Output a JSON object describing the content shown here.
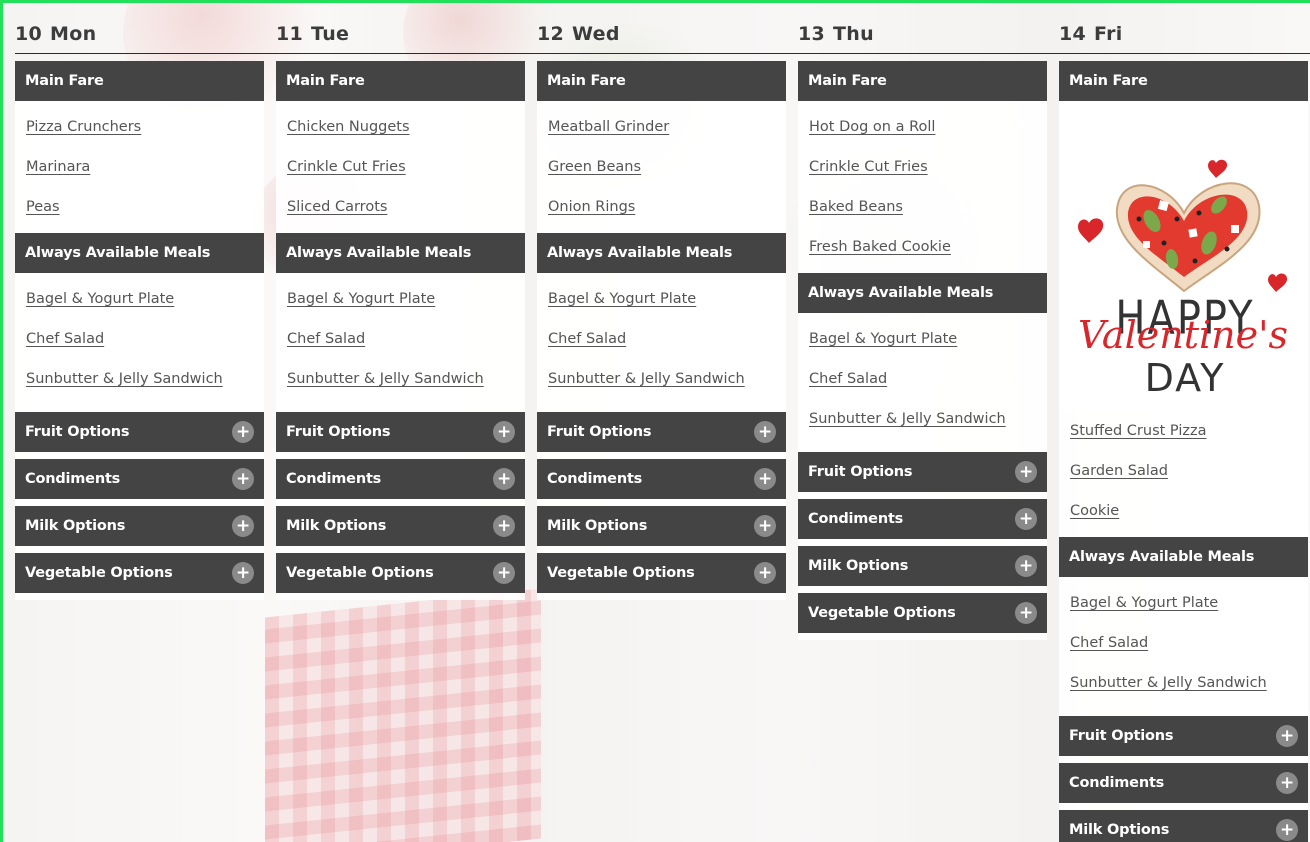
{
  "days": [
    {
      "num": "10",
      "name": "Mon",
      "main_fare_label": "Main Fare",
      "main_fare": [
        "Pizza Crunchers",
        "Marinara",
        "Peas"
      ],
      "always_label": "Always Available Meals",
      "always": [
        "Bagel & Yogurt Plate",
        "Chef Salad",
        "Sunbutter & Jelly Sandwich"
      ],
      "options": [
        "Fruit Options",
        "Condiments",
        "Milk Options",
        "Vegetable Options"
      ]
    },
    {
      "num": "11",
      "name": "Tue",
      "main_fare_label": "Main Fare",
      "main_fare": [
        "Chicken Nuggets",
        "Crinkle Cut Fries",
        "Sliced Carrots"
      ],
      "always_label": "Always Available Meals",
      "always": [
        "Bagel & Yogurt Plate",
        "Chef Salad",
        "Sunbutter & Jelly Sandwich"
      ],
      "options": [
        "Fruit Options",
        "Condiments",
        "Milk Options",
        "Vegetable Options"
      ]
    },
    {
      "num": "12",
      "name": "Wed",
      "main_fare_label": "Main Fare",
      "main_fare": [
        "Meatball Grinder",
        "Green Beans",
        "Onion Rings"
      ],
      "always_label": "Always Available Meals",
      "always": [
        "Bagel & Yogurt Plate",
        "Chef Salad",
        "Sunbutter & Jelly Sandwich"
      ],
      "options": [
        "Fruit Options",
        "Condiments",
        "Milk Options",
        "Vegetable Options"
      ]
    },
    {
      "num": "13",
      "name": "Thu",
      "main_fare_label": "Main Fare",
      "main_fare": [
        "Hot Dog on a Roll",
        "Crinkle Cut Fries",
        "Baked Beans",
        "Fresh Baked Cookie"
      ],
      "always_label": "Always Available Meals",
      "always": [
        "Bagel & Yogurt Plate",
        "Chef Salad",
        "Sunbutter & Jelly Sandwich"
      ],
      "options": [
        "Fruit Options",
        "Condiments",
        "Milk Options",
        "Vegetable Options"
      ]
    },
    {
      "num": "14",
      "name": "Fri",
      "main_fare_label": "Main Fare",
      "main_fare": [
        "Stuffed Crust Pizza",
        "Garden Salad",
        "Cookie"
      ],
      "always_label": "Always Available Meals",
      "always": [
        "Bagel & Yogurt Plate",
        "Chef Salad",
        "Sunbutter & Jelly Sandwich"
      ],
      "options": [
        "Fruit Options",
        "Condiments",
        "Milk Options"
      ],
      "art": {
        "line1": "HAPPY",
        "line2": "Valentine's",
        "line3": "DAY"
      }
    }
  ],
  "colors": {
    "bar": "#444444",
    "plus": "#8a8a8a",
    "frame": "#22e05a",
    "valentine_red": "#d9262b"
  },
  "icons": {
    "expand": "plus-circle-icon"
  }
}
